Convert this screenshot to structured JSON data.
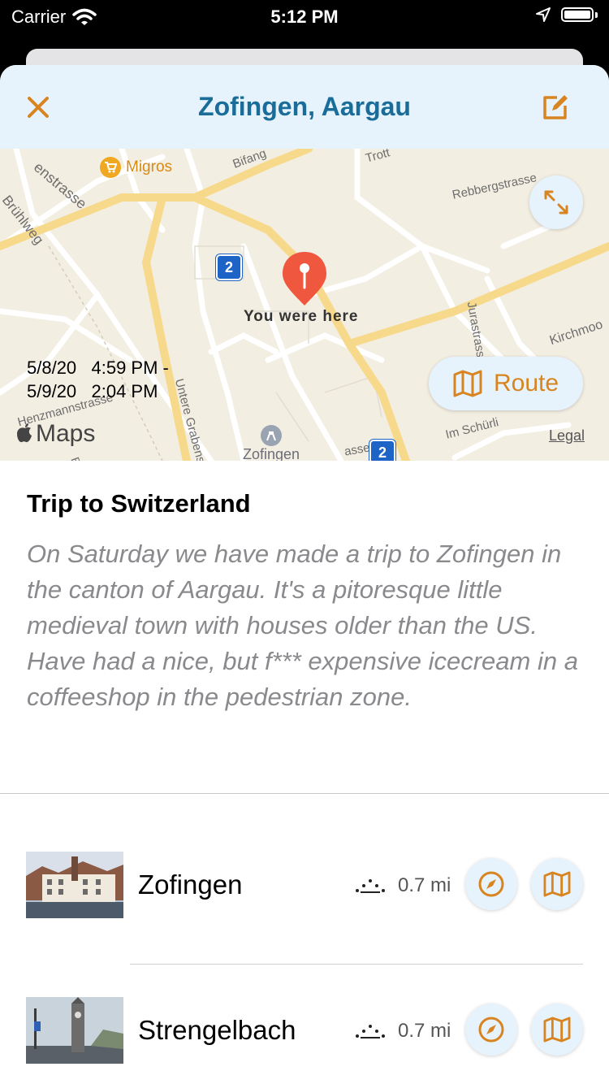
{
  "status_bar": {
    "carrier": "Carrier",
    "time": "5:12 PM"
  },
  "nav": {
    "title": "Zofingen, Aargau",
    "close_icon": "close-icon",
    "edit_icon": "edit-icon"
  },
  "map": {
    "labels": {
      "migros": "Migros",
      "bifang": "Bifang",
      "trott": "Trott",
      "enstrasse": "enstrasse",
      "bruhlweg": "Brühlweg",
      "rebbergstrasse": "Rebbergstrasse",
      "jurastrasse": "Jurastrasse",
      "kirchmoo": "Kirchmoo",
      "zofingen": "Zofingen",
      "henzmannstrasse": "Henzmannstrasse",
      "grabenstr": "Untere Grabenstr.",
      "im_schurli": "Im Schürli",
      "asse": "asse",
      "br": "Br"
    },
    "road_badge": "2",
    "pin_label": "You were here",
    "date_range": "5/8/20   4:59 PM -\n5/9/20   2:04 PM",
    "route_label": "Route",
    "maps_label": "Maps",
    "legal_label": "Legal"
  },
  "trip": {
    "title": "Trip to Switzerland",
    "description": "On Saturday we have made a trip to Zofingen in the canton of Aargau. It's a pitoresque little medieval town with houses older than the US. Have had a nice, but f*** expensive icecream in a coffeeshop in the pedestrian zone."
  },
  "places": [
    {
      "name": "Zofingen",
      "distance": "0.7 mi"
    },
    {
      "name": "Strengelbach",
      "distance": "0.7 mi"
    }
  ],
  "colors": {
    "accent": "#d88420",
    "nav_bg": "#e6f3fd",
    "title_blue": "#1a6d99",
    "pin": "#f0573f"
  }
}
